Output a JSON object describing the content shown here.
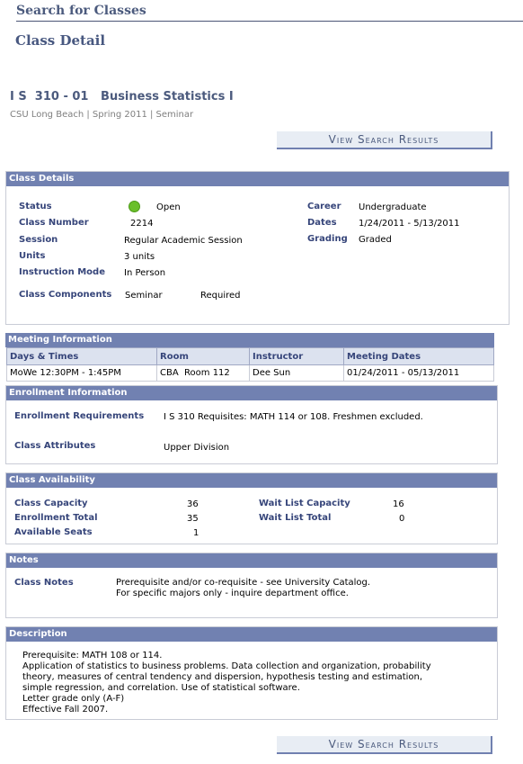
{
  "header": {
    "breadcrumb_title": "Search for Classes",
    "page_title": "Class Detail"
  },
  "class": {
    "title": "I S  310 - 01   Business Statistics I",
    "subtitle": "CSU Long Beach | Spring 2011 | Seminar"
  },
  "buttons": {
    "view_search_results": "View Search Results"
  },
  "class_details": {
    "heading": "Class Details",
    "status_label": "Status",
    "status_value": "Open",
    "status_icon": "open-circle-icon",
    "status_color": "#6abf2a",
    "class_number_label": "Class Number",
    "class_number_value": "2214",
    "session_label": "Session",
    "session_value": "Regular Academic Session",
    "units_label": "Units",
    "units_value": "3 units",
    "instruction_mode_label": "Instruction Mode",
    "instruction_mode_value": "In Person",
    "class_components_label": "Class Components",
    "class_components_value": "Seminar",
    "class_components_req": "Required",
    "career_label": "Career",
    "career_value": "Undergraduate",
    "dates_label": "Dates",
    "dates_value": "1/24/2011 - 5/13/2011",
    "grading_label": "Grading",
    "grading_value": "Graded"
  },
  "meeting_information": {
    "heading": "Meeting Information",
    "columns": [
      "Days & Times",
      "Room",
      "Instructor",
      "Meeting Dates"
    ],
    "rows": [
      [
        "MoWe 12:30PM - 1:45PM",
        "CBA  Room 112",
        "Dee Sun",
        "01/24/2011 - 05/13/2011"
      ]
    ]
  },
  "enrollment_information": {
    "heading": "Enrollment Information",
    "requirements_label": "Enrollment Requirements",
    "requirements_value": "I S 310 Requisites: MATH 114 or 108. Freshmen excluded.",
    "attributes_label": "Class Attributes",
    "attributes_value": "Upper Division"
  },
  "class_availability": {
    "heading": "Class Availability",
    "capacity_label": "Class Capacity",
    "capacity_value": "36",
    "enrollment_total_label": "Enrollment Total",
    "enrollment_total_value": "35",
    "available_seats_label": "Available Seats",
    "available_seats_value": "1",
    "wait_list_capacity_label": "Wait List Capacity",
    "wait_list_capacity_value": "16",
    "wait_list_total_label": "Wait List Total",
    "wait_list_total_value": "0"
  },
  "notes": {
    "heading": "Notes",
    "class_notes_label": "Class Notes",
    "class_notes_line1": "Prerequisite and/or co-requisite - see University Catalog.",
    "class_notes_line2": "For specific majors only - inquire department office."
  },
  "description": {
    "heading": "Description",
    "text": "Prerequisite: MATH 108 or 114.\nApplication of statistics to business problems. Data collection and organization, probability\ntheory, measures of central tendency and dispersion, hypothesis testing and estimation,\nsimple regression, and correlation. Use of statistical software.\nLetter grade only (A-F)\nEffective Fall 2007."
  }
}
